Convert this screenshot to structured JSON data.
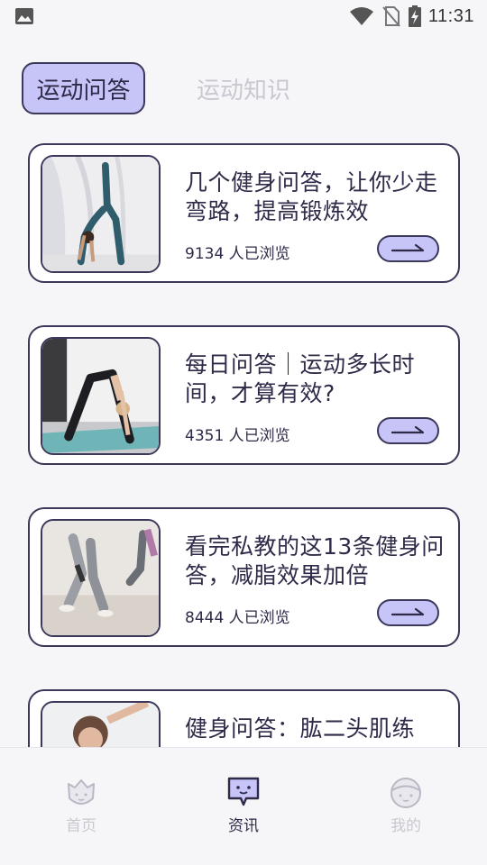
{
  "status_bar": {
    "time": "11:31",
    "icons": [
      "gallery-icon",
      "wifi-icon",
      "no-sim-icon",
      "battery-charging-icon"
    ]
  },
  "tabs": [
    {
      "label": "运动问答",
      "active": true
    },
    {
      "label": "运动知识",
      "active": false
    }
  ],
  "articles": [
    {
      "title": "几个健身问答，让你少走弯路，提高锻炼效",
      "views": "9134 人已浏览"
    },
    {
      "title": "每日问答｜运动多长时间，才算有效?",
      "views": "4351 人已浏览"
    },
    {
      "title": "看完私教的这13条健身问答，减脂效果加倍",
      "views": "8444 人已浏览"
    },
    {
      "title": "健身问答：肱二头肌练",
      "views": ""
    }
  ],
  "bottom_nav": [
    {
      "label": "首页",
      "icon": "flower-icon",
      "active": false
    },
    {
      "label": "资讯",
      "icon": "chat-bubble-icon",
      "active": true
    },
    {
      "label": "我的",
      "icon": "face-icon",
      "active": false
    }
  ],
  "colors": {
    "accent": "#c7c4f8",
    "border": "#3b385a",
    "text": "#2e2a48",
    "inactive": "#c9c8d0",
    "background": "#f6f6f8"
  }
}
